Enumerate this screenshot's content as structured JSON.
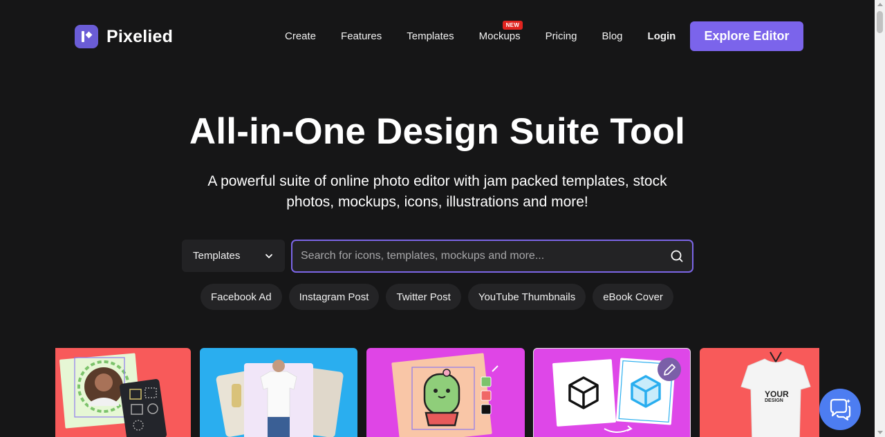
{
  "brand": {
    "name": "Pixelied"
  },
  "nav": {
    "items": [
      "Create",
      "Features",
      "Templates",
      "Mockups",
      "Pricing",
      "Blog"
    ],
    "new_badge": "NEW",
    "login": "Login",
    "cta": "Explore Editor"
  },
  "hero": {
    "title": "All-in-One Design Suite Tool",
    "subtitle": "A powerful suite of online photo editor with jam packed templates, stock photos, mockups, icons, illustrations and more!"
  },
  "search": {
    "category": "Templates",
    "placeholder": "Search for icons, templates, mockups and more..."
  },
  "chips": [
    "Facebook Ad",
    "Instagram Post",
    "Twitter Post",
    "YouTube Thumbnails",
    "eBook Cover"
  ],
  "cards": {
    "tshirt_text_line1": "YOUR",
    "tshirt_text_line2": "DESIGN"
  },
  "colors": {
    "background": "#161617",
    "accent": "#7b64eb",
    "chat": "#4d7df1",
    "new_badge": "#e1241f"
  }
}
